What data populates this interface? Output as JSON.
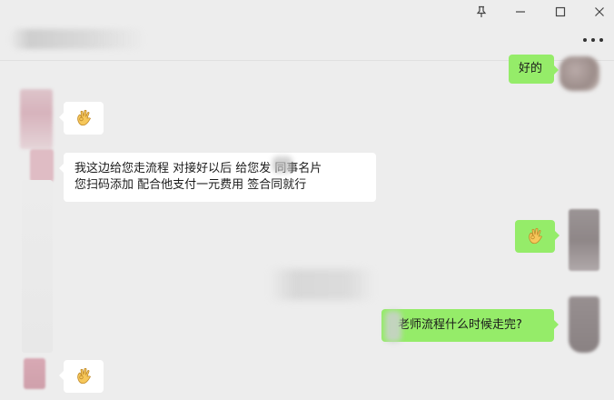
{
  "titlebar": {
    "icons": [
      "pin-icon",
      "minimize-icon",
      "maximize-icon",
      "close-icon"
    ]
  },
  "header": {
    "more_icon": "more-icon"
  },
  "messages": [
    {
      "side": "sent",
      "type": "text",
      "text": "好的"
    },
    {
      "side": "received",
      "type": "emoji",
      "emoji": "ok-hand-emoji"
    },
    {
      "side": "received",
      "type": "text",
      "lines": [
        "我这边给您走流程 对接好以后 给您发 同事名片",
        "您扫码添加  配合他支付一元费用 签合同就行"
      ]
    },
    {
      "side": "sent",
      "type": "emoji",
      "emoji": "ok-hand-emoji"
    },
    {
      "side": "sent",
      "type": "text",
      "text": "老师流程什么时候走完?"
    },
    {
      "side": "received",
      "type": "emoji",
      "emoji": "ok-hand-emoji"
    }
  ],
  "colors": {
    "background": "#ededed",
    "sent_bubble": "#95ec69",
    "received_bubble": "#ffffff",
    "text": "#1a1a1a"
  }
}
